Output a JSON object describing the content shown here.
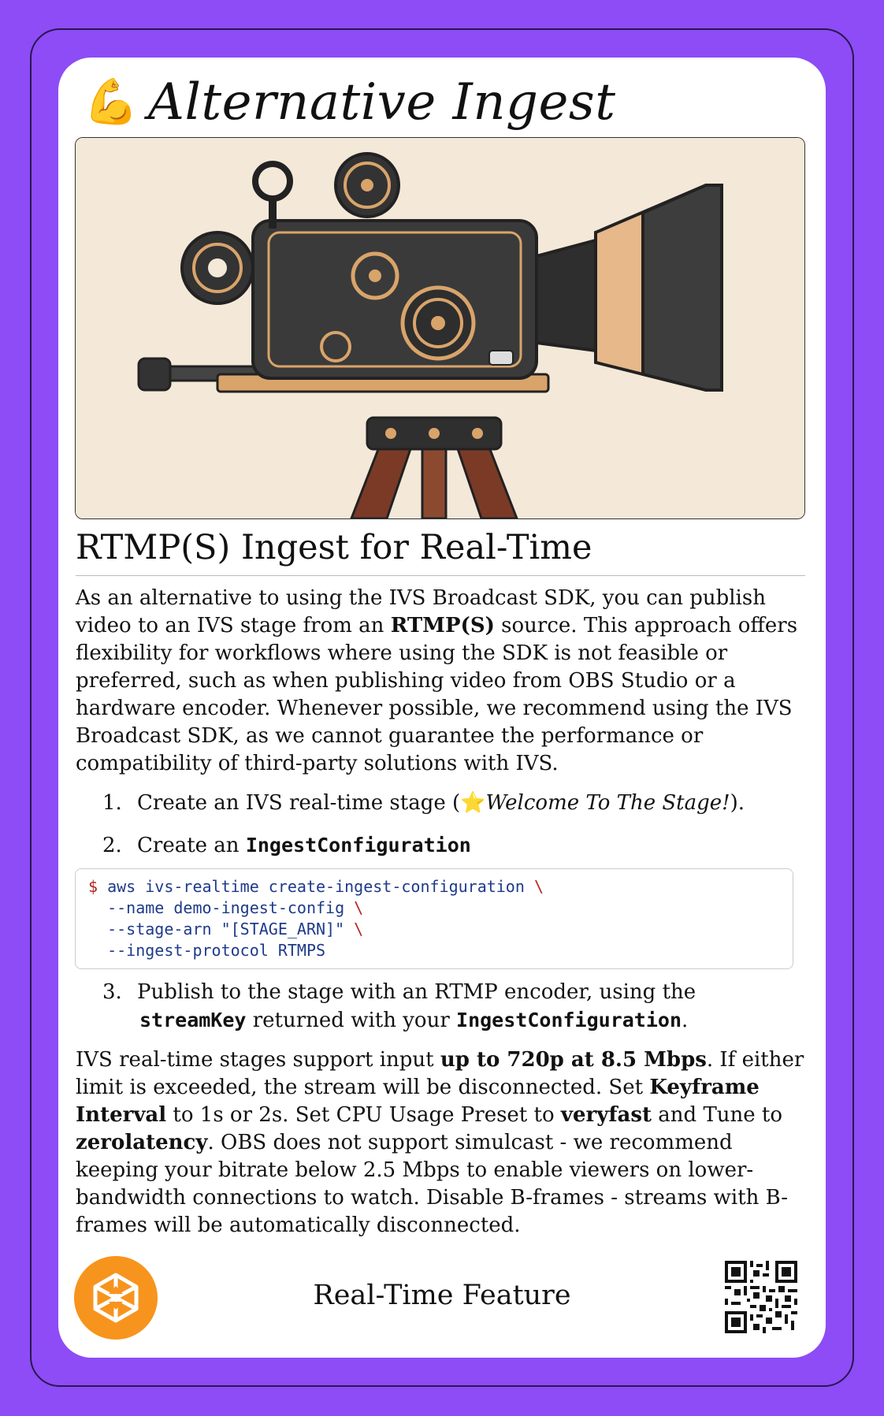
{
  "header": {
    "emoji": "💪",
    "title": "Alternative Ingest"
  },
  "section": {
    "heading": "RTMP(S) Ingest for Real-Time"
  },
  "intro": {
    "t1": "As an alternative to using the IVS Broadcast SDK, you can publish video to an IVS stage from an ",
    "b1": "RTMP(S)",
    "t2": " source. This approach offers flexibility for workflows where using the SDK is not feasible or preferred, such as when publishing video from OBS Studio or a hardware encoder. Whenever possible, we recommend using the IVS Broadcast SDK, as we cannot guarantee the performance or compatibility of third-party solutions with IVS."
  },
  "steps": {
    "s1": {
      "num": "1.",
      "t1": "Create an IVS real-time stage (",
      "emoji": "⭐",
      "italic": "Welcome To The Stage!",
      "t2": ")."
    },
    "s2": {
      "num": "2.",
      "t1": "Create an ",
      "code": "IngestConfiguration"
    },
    "s3": {
      "num": "3.",
      "t1": "Publish to the stage with an RTMP encoder, using the",
      "code1": "streamKey",
      "t2": " returned with your ",
      "code2": "IngestConfiguration",
      "t3": "."
    }
  },
  "code": {
    "prompt": "$",
    "l1": " aws ivs-realtime create-ingest-configuration ",
    "l2": "  --name demo-ingest-config ",
    "l3": "  --stage-arn \"[STAGE_ARN]\" ",
    "l4": "  --ingest-protocol RTMPS",
    "cont": "\\"
  },
  "notes": {
    "t1": "IVS real-time stages support input ",
    "b1": "up to 720p at 8.5 Mbps",
    "t2": ". If either limit is exceeded, the stream will be disconnected. Set ",
    "b2": "Keyframe Interval",
    "t3": " to 1s or 2s. Set CPU Usage Preset to ",
    "b3": "veryfast",
    "t4": " and Tune to ",
    "b4": "zerolatency",
    "t5": ". OBS does not support simulcast - we recommend keeping your bitrate below 2.5 Mbps to enable viewers on lower-bandwidth connections to watch. Disable B-frames - streams with B-frames will be automatically disconnected."
  },
  "footer": {
    "label": "Real-Time Feature"
  },
  "colors": {
    "background": "#8d4cf5",
    "card": "#ffffff",
    "logo": "#f7941d",
    "code_text": "#1e3a8a",
    "code_accent": "#b3261e"
  }
}
